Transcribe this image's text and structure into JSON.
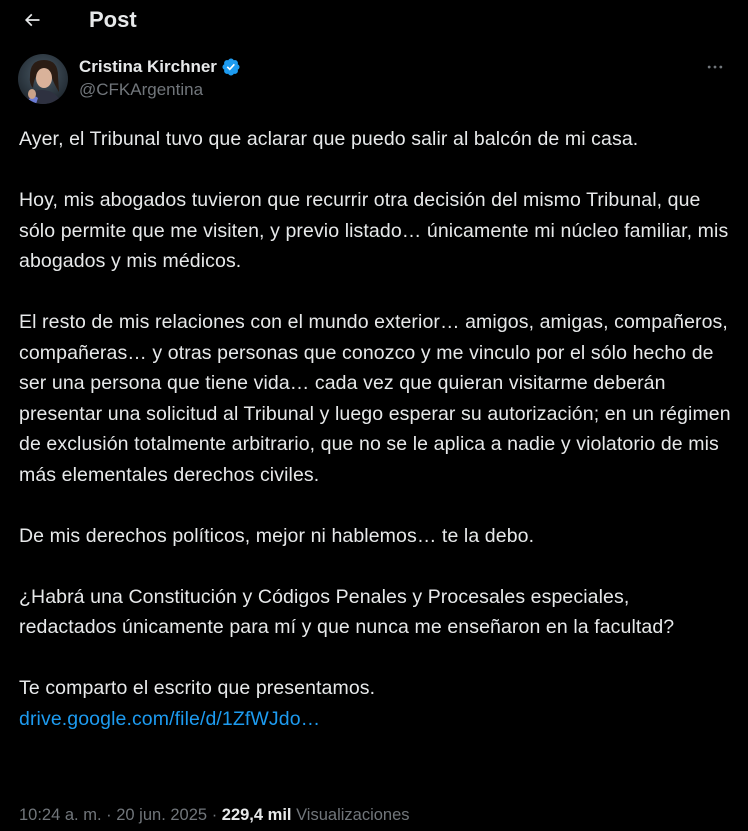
{
  "header": {
    "title": "Post",
    "back_icon": "arrow-left-icon"
  },
  "author": {
    "display_name": "Cristina Kirchner",
    "handle": "@CFKArgentina",
    "verified": true,
    "verified_color": "#1d9bf0",
    "more_icon": "more-horizontal-icon"
  },
  "post": {
    "paragraphs": [
      "Ayer, el Tribunal tuvo que aclarar que puedo salir al balcón de mi casa.",
      "Hoy, mis abogados tuvieron que recurrir otra decisión del mismo Tribunal, que sólo permite que me visiten, y previo listado… únicamente mi núcleo familiar, mis abogados y mis médicos.",
      "El resto de mis relaciones con el mundo exterior… amigos, amigas, compañeros, compañeras… y otras personas que conozco y me vinculo por el sólo hecho de ser una persona que tiene vida… cada vez que quieran visitarme deberán presentar una solicitud al Tribunal y luego esperar su autorización; en un régimen de exclusión totalmente arbitrario, que no se le aplica a nadie y violatorio de mis más elementales derechos civiles.",
      "De mis derechos políticos, mejor ni hablemos… te la debo.",
      "¿Habrá una Constitución y Códigos Penales y Procesales especiales, redactados únicamente para mí y que nunca me enseñaron en la facultad?"
    ],
    "closing_line": "Te comparto el escrito que presentamos.",
    "link_text": "drive.google.com/file/d/1ZfWJdo…",
    "link_color": "#1d9bf0"
  },
  "meta": {
    "time": "10:24 a. m.",
    "separator": "·",
    "date": "20 jun. 2025",
    "views_count": "229,4 mil",
    "views_label": "Visualizaciones"
  }
}
